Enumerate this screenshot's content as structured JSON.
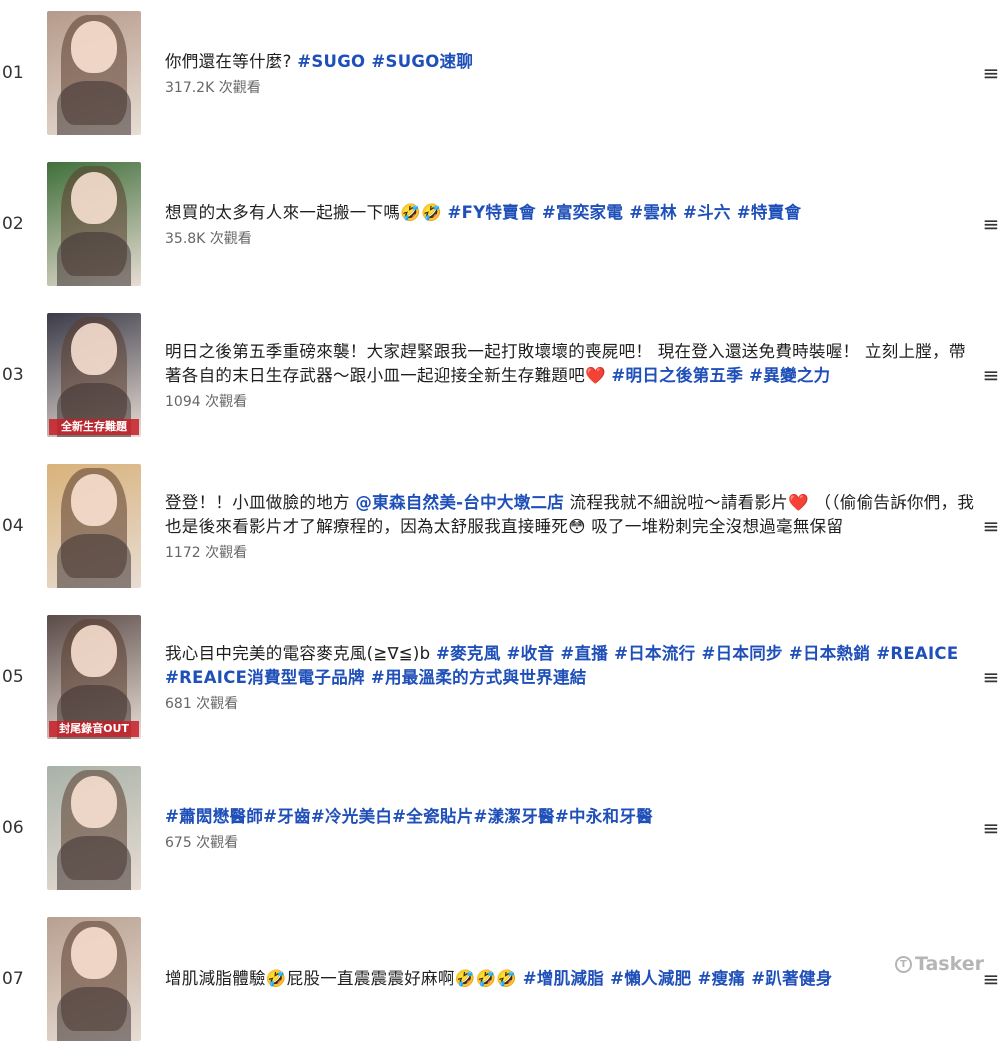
{
  "videos": [
    {
      "rank": "01",
      "title_plain": "你們還在等什麼? ",
      "title_tags": "#SUGO #SUGO速聊",
      "views": "317.2K 次觀看",
      "thumb_color": "#b59a8a",
      "thumb_caption": ""
    },
    {
      "rank": "02",
      "title_plain": "想買的太多有人來一起搬一下嗎🤣🤣 ",
      "title_tags": "#FY特賣會 #富奕家電 #雲林 #斗六 #特賣會",
      "views": "35.8K 次觀看",
      "thumb_color": "#3f6f3a",
      "thumb_caption": ""
    },
    {
      "rank": "03",
      "title_plain": "明日之後第五季重磅來襲！大家趕緊跟我一起打敗壞壞的喪屍吧！ 現在登入還送免費時裝喔！ 立刻上膛，帶著各自的末日生存武器～跟小皿一起迎接全新生存難題吧❤️ ",
      "title_tags": "#明日之後第五季 #異變之力",
      "views": "1094 次觀看",
      "thumb_color": "#3a3a48",
      "thumb_caption": "全新生存難題"
    },
    {
      "rank": "04",
      "title_plain": "登登！！小皿做臉的地方 ",
      "title_tags": "@東森自然美-台中大墩二店",
      "title_rest": " 流程我就不細說啦～請看影片❤️ （（偷偷告訴你們，我也是後來看影片才了解療程的，因為太舒服我直接睡死😳 吸了一堆粉刺完全沒想過毫無保留",
      "views": "1172 次觀看",
      "thumb_color": "#d8b27a",
      "thumb_caption": ""
    },
    {
      "rank": "05",
      "title_plain": "我心目中完美的電容麥克風(≧∇≦)b ",
      "title_tags": "#麥克風 #收音 #直播 #日本流行 #日本同步 #日本熱銷 #REAICE #REAICE消費型電子品牌 #用最溫柔的方式與世界連結",
      "views": "681 次觀看",
      "thumb_color": "#5a4a48",
      "thumb_caption": "封尾錄音OUT"
    },
    {
      "rank": "06",
      "title_plain": "",
      "title_tags": "#蕭閎懋醫師#牙齒#冷光美白#全瓷貼片#漾潔牙醫#中永和牙醫",
      "views": "675 次觀看",
      "thumb_color": "#a8b2a8",
      "thumb_caption": ""
    },
    {
      "rank": "07",
      "title_plain": "增肌減脂體驗🤣屁股一直震震震好麻啊🤣🤣🤣 ",
      "title_tags": "#增肌減脂 #懶人減肥 #瘦痛 #趴著健身",
      "views": "",
      "thumb_color": "#b8a090",
      "thumb_caption": ""
    }
  ],
  "menu_glyph": "≡",
  "watermark": {
    "text": "Tasker",
    "logo_glyph": "T"
  }
}
